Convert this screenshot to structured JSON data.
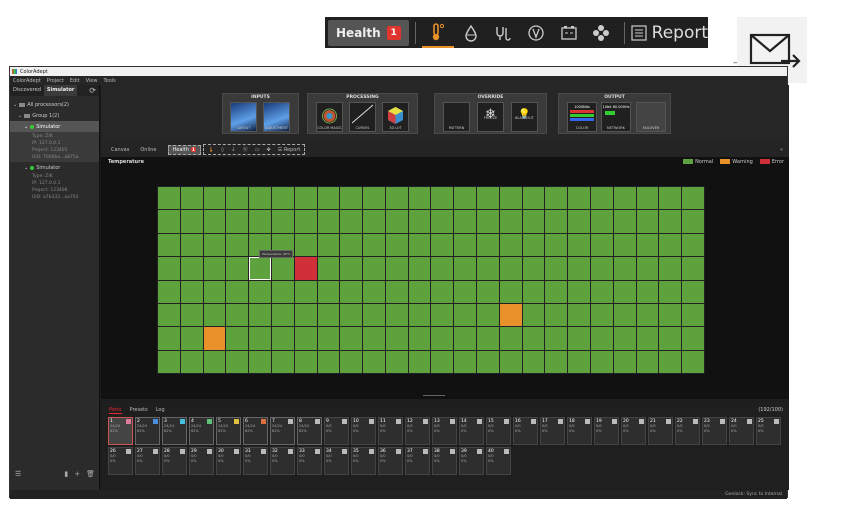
{
  "zoom_toolbar": {
    "health_label": "Health",
    "health_badge": "1",
    "icons": [
      "thermometer-icon",
      "droplet-icon",
      "plug-icon",
      "voltage-icon",
      "battery-icon",
      "fan-icon"
    ],
    "report_label": "Report",
    "active_color": "#e8902a"
  },
  "window": {
    "title": "ColorAdept",
    "menu": [
      "ColorAdept",
      "Project",
      "Edit",
      "View",
      "Tools"
    ]
  },
  "sidebar": {
    "tabs": [
      "Discovered",
      "Simulator"
    ],
    "all_processors": "All processors(2)",
    "group": "Group 1(2)",
    "devices": [
      {
        "name": "Simulator",
        "type": "Type: ZIK",
        "ip": "IP: 127.0.0.1",
        "project": "Project: 123405",
        "uid": "UID: 7000ba...a875a"
      },
      {
        "name": "Simulator",
        "type": "Type: ZIK",
        "ip": "IP: 127.0.0.1",
        "project": "Project: 123406",
        "uid": "UID: a7b332...aa793"
      }
    ]
  },
  "pipeline": {
    "inputs": {
      "title": "INPUTS",
      "cards": [
        "LAYOUT",
        "ADJUSTMENT"
      ]
    },
    "processing": {
      "title": "PROCESSING",
      "cards": [
        "COLOR MAGIC",
        "CURVES",
        "3D LUT"
      ]
    },
    "override": {
      "title": "OVERRIDE",
      "cards": [
        "PATTERN",
        "FREEZE",
        "BLACKOUT"
      ]
    },
    "output": {
      "title": "OUTPUT",
      "cards": [
        {
          "label": "COLOR",
          "value": "1000Nits"
        },
        {
          "label": "NETWORK",
          "value": "10bit 60.000Hz"
        },
        {
          "label": "FAILOVER",
          "value": ""
        }
      ]
    }
  },
  "view_tabs": {
    "canvas": "Canvas",
    "online": "Online",
    "health": "Health",
    "health_badge": "1",
    "report": "Report"
  },
  "view": {
    "title": "Temperature",
    "legend": [
      {
        "label": "Normal",
        "color": "#5da23c"
      },
      {
        "label": "Warning",
        "color": "#e8902a"
      },
      {
        "label": "Error",
        "color": "#d0303a"
      }
    ],
    "tooltip": "Temperature: 45°C",
    "grid": {
      "cols": 24,
      "rows": 8,
      "warning_cells": [
        [
          2,
          6
        ],
        [
          15,
          5
        ]
      ],
      "error_cells": [
        [
          6,
          3
        ]
      ],
      "hover_cell": [
        4,
        3
      ]
    }
  },
  "bottom": {
    "tabs": [
      "Ports",
      "Presets",
      "Log"
    ],
    "count": "(192/100)",
    "ports": [
      {
        "n": "1",
        "v1": "24/24",
        "v2": "",
        "v3": "62%",
        "c": "#e07a9a"
      },
      {
        "n": "2",
        "v1": "24/24",
        "v2": "",
        "v3": "62%",
        "c": "#4a8fe0"
      },
      {
        "n": "3",
        "v1": "24/24",
        "v2": "",
        "v3": "62%",
        "c": "#47c0e0"
      },
      {
        "n": "4",
        "v1": "24/24",
        "v2": "",
        "v3": "62%",
        "c": "#5fc07a"
      },
      {
        "n": "5",
        "v1": "24/24",
        "v2": "",
        "v3": "62%",
        "c": "#e0c040"
      },
      {
        "n": "6",
        "v1": "24/24",
        "v2": "",
        "v3": "62%",
        "c": "#e07040"
      },
      {
        "n": "7",
        "v1": "24/24",
        "v2": "",
        "v3": "62%",
        "c": "#bbbbbb"
      },
      {
        "n": "8",
        "v1": "24/24",
        "v2": "",
        "v3": "62%",
        "c": "#bbbbbb"
      },
      {
        "n": "9",
        "v1": "0/0",
        "v2": "",
        "v3": "0%",
        "c": "#bbbbbb"
      },
      {
        "n": "10",
        "v1": "0/0",
        "v2": "",
        "v3": "0%",
        "c": "#bbbbbb"
      },
      {
        "n": "11",
        "v1": "0/0",
        "v2": "",
        "v3": "0%",
        "c": "#bbbbbb"
      },
      {
        "n": "12",
        "v1": "0/0",
        "v2": "",
        "v3": "0%",
        "c": "#bbbbbb"
      },
      {
        "n": "13",
        "v1": "0/0",
        "v2": "",
        "v3": "0%",
        "c": "#bbbbbb"
      },
      {
        "n": "14",
        "v1": "0/0",
        "v2": "",
        "v3": "0%",
        "c": "#bbbbbb"
      },
      {
        "n": "15",
        "v1": "0/0",
        "v2": "",
        "v3": "0%",
        "c": "#bbbbbb"
      },
      {
        "n": "16",
        "v1": "0/0",
        "v2": "",
        "v3": "0%",
        "c": "#bbbbbb"
      },
      {
        "n": "17",
        "v1": "0/0",
        "v2": "",
        "v3": "0%",
        "c": "#bbbbbb"
      },
      {
        "n": "18",
        "v1": "0/0",
        "v2": "",
        "v3": "0%",
        "c": "#bbbbbb"
      },
      {
        "n": "19",
        "v1": "0/0",
        "v2": "",
        "v3": "0%",
        "c": "#bbbbbb"
      },
      {
        "n": "20",
        "v1": "0/0",
        "v2": "",
        "v3": "0%",
        "c": "#bbbbbb"
      },
      {
        "n": "21",
        "v1": "0/0",
        "v2": "",
        "v3": "0%",
        "c": "#bbbbbb"
      },
      {
        "n": "22",
        "v1": "0/0",
        "v2": "",
        "v3": "0%",
        "c": "#bbbbbb"
      },
      {
        "n": "23",
        "v1": "0/0",
        "v2": "",
        "v3": "0%",
        "c": "#bbbbbb"
      },
      {
        "n": "24",
        "v1": "0/0",
        "v2": "",
        "v3": "0%",
        "c": "#bbbbbb"
      },
      {
        "n": "25",
        "v1": "0/0",
        "v2": "",
        "v3": "0%",
        "c": "#bbbbbb"
      },
      {
        "n": "26",
        "v1": "0/0",
        "v2": "",
        "v3": "0%",
        "c": "#bbbbbb"
      },
      {
        "n": "27",
        "v1": "0/0",
        "v2": "",
        "v3": "0%",
        "c": "#bbbbbb"
      },
      {
        "n": "28",
        "v1": "0/0",
        "v2": "",
        "v3": "0%",
        "c": "#bbbbbb"
      },
      {
        "n": "29",
        "v1": "0/0",
        "v2": "",
        "v3": "0%",
        "c": "#bbbbbb"
      },
      {
        "n": "30",
        "v1": "0/0",
        "v2": "",
        "v3": "0%",
        "c": "#bbbbbb"
      },
      {
        "n": "31",
        "v1": "0/0",
        "v2": "",
        "v3": "0%",
        "c": "#bbbbbb"
      },
      {
        "n": "32",
        "v1": "0/0",
        "v2": "",
        "v3": "0%",
        "c": "#bbbbbb"
      },
      {
        "n": "33",
        "v1": "0/0",
        "v2": "",
        "v3": "0%",
        "c": "#bbbbbb"
      },
      {
        "n": "34",
        "v1": "0/0",
        "v2": "",
        "v3": "0%",
        "c": "#bbbbbb"
      },
      {
        "n": "35",
        "v1": "0/0",
        "v2": "",
        "v3": "0%",
        "c": "#bbbbbb"
      },
      {
        "n": "36",
        "v1": "0/0",
        "v2": "",
        "v3": "0%",
        "c": "#bbbbbb"
      },
      {
        "n": "37",
        "v1": "0/0",
        "v2": "",
        "v3": "0%",
        "c": "#bbbbbb"
      },
      {
        "n": "38",
        "v1": "0/0",
        "v2": "",
        "v3": "0%",
        "c": "#bbbbbb"
      },
      {
        "n": "39",
        "v1": "0/0",
        "v2": "",
        "v3": "0%",
        "c": "#bbbbbb"
      },
      {
        "n": "40",
        "v1": "0/0",
        "v2": "",
        "v3": "0%",
        "c": "#bbbbbb"
      }
    ]
  },
  "statusbar": {
    "text": "Genlock: Sync to Internal"
  }
}
